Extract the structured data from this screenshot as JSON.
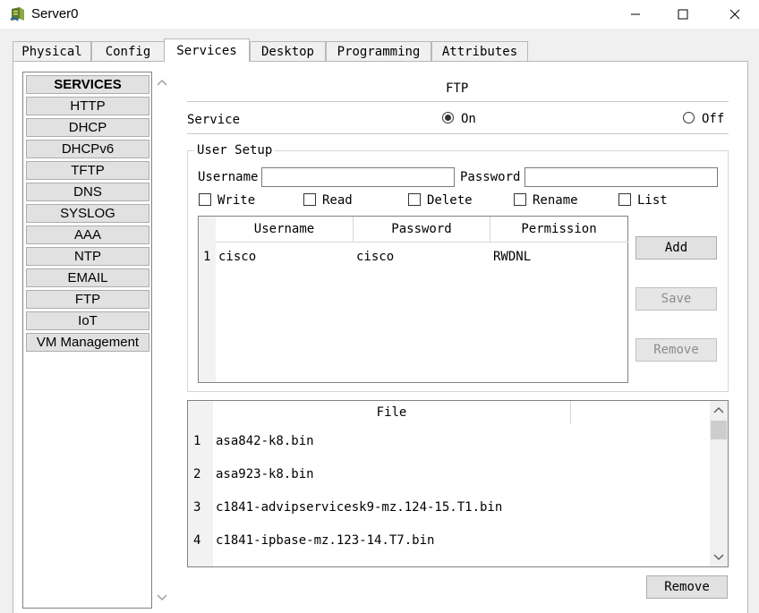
{
  "window": {
    "title": "Server0"
  },
  "tabs": [
    "Physical",
    "Config",
    "Services",
    "Desktop",
    "Programming",
    "Attributes"
  ],
  "sidebar": {
    "header": "SERVICES",
    "items": [
      "HTTP",
      "DHCP",
      "DHCPv6",
      "TFTP",
      "DNS",
      "SYSLOG",
      "AAA",
      "NTP",
      "EMAIL",
      "FTP",
      "IoT",
      "VM Management"
    ]
  },
  "ftp": {
    "section_title": "FTP",
    "service_label": "Service",
    "on_label": "On",
    "off_label": "Off",
    "service_state": "On",
    "user_setup": {
      "title": "User Setup",
      "username_label": "Username",
      "password_label": "Password",
      "username_value": "",
      "password_value": "",
      "permissions": [
        "Write",
        "Read",
        "Delete",
        "Rename",
        "List"
      ],
      "table": {
        "columns": [
          "Username",
          "Password",
          "Permission"
        ],
        "rows": [
          {
            "index": "1",
            "username": "cisco",
            "password": "cisco",
            "permission": "RWDNL"
          }
        ]
      },
      "buttons": {
        "add": "Add",
        "save": "Save",
        "remove": "Remove"
      }
    },
    "files": {
      "column": "File",
      "rows": [
        {
          "index": "1",
          "name": "asa842-k8.bin"
        },
        {
          "index": "2",
          "name": "asa923-k8.bin"
        },
        {
          "index": "3",
          "name": "c1841-advipservicesk9-mz.124-15.T1.bin"
        },
        {
          "index": "4",
          "name": "c1841-ipbase-mz.123-14.T7.bin"
        }
      ],
      "remove_label": "Remove"
    }
  }
}
